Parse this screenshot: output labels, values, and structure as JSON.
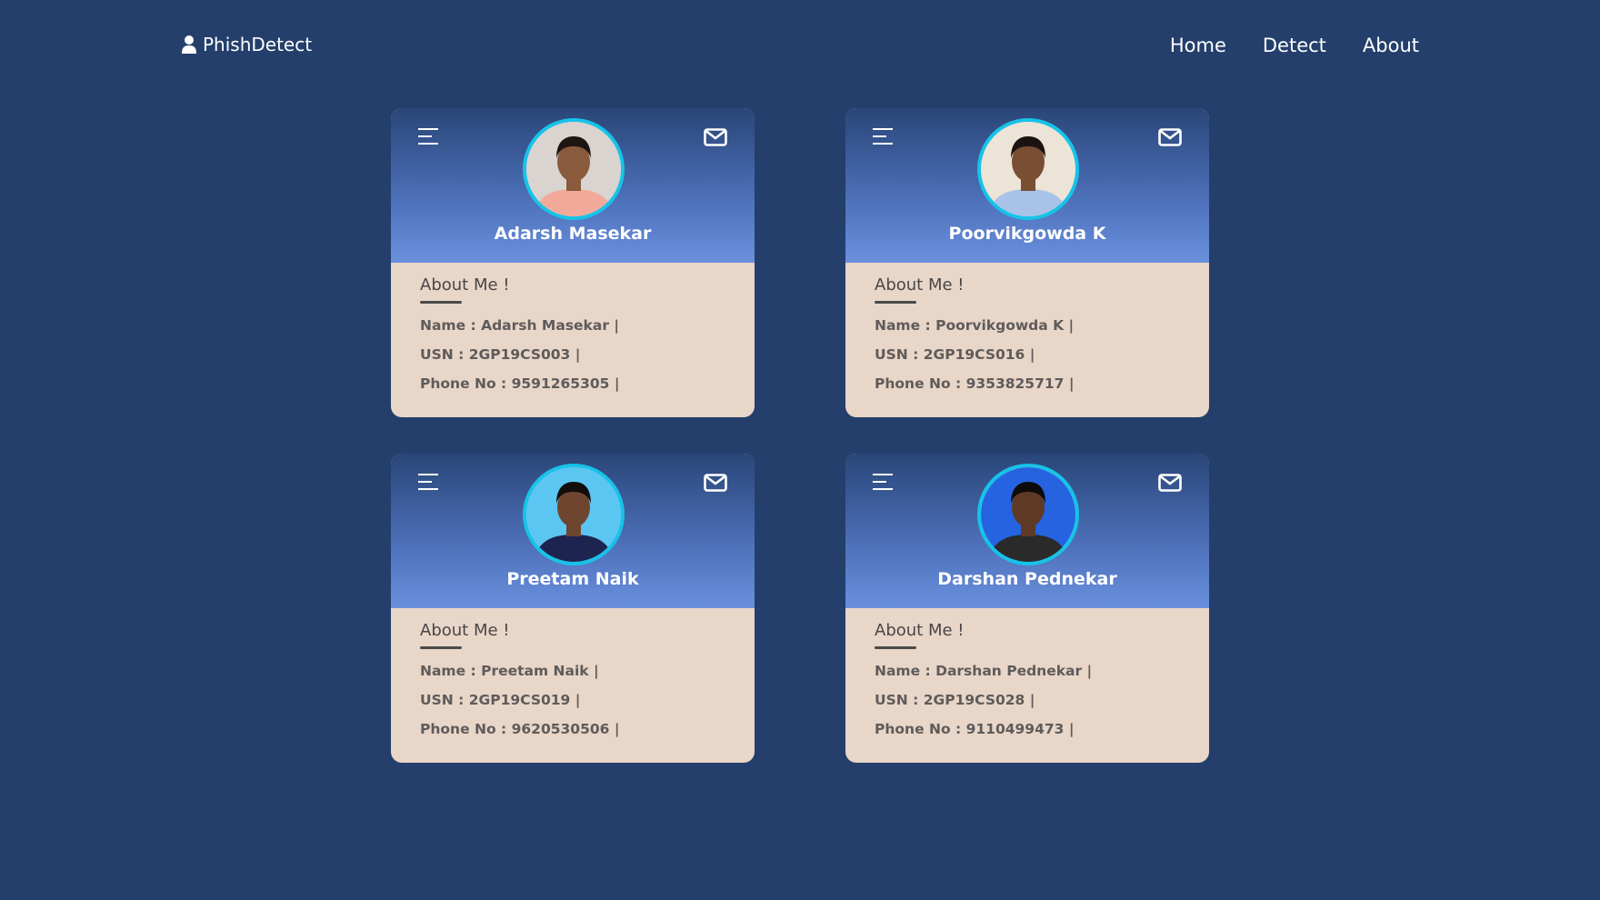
{
  "nav": {
    "brand": "PhishDetect",
    "brand_icon": "user-icon",
    "links": [
      "Home",
      "Detect",
      "About"
    ]
  },
  "colors": {
    "background": "#243f6b",
    "card_header_top": "#2a4678",
    "card_header_bottom": "#6a90de",
    "card_body": "#e8d6c8",
    "avatar_ring": "#17c3e8"
  },
  "cards": [
    {
      "name": "Adarsh Masekar",
      "about_title": "About Me !",
      "name_line": "Name : Adarsh Masekar |",
      "usn_line": "USN : 2GP19CS003 |",
      "phone_line": "Phone No : 9591265305 |",
      "photo_bg": "#d9d4d0",
      "shirt_color": "#f3a99a",
      "skin_color": "#8a5a3c",
      "hair_color": "#1c1512"
    },
    {
      "name": "Poorvikgowda K",
      "about_title": "About Me !",
      "name_line": "Name : Poorvikgowda K |",
      "usn_line": "USN : 2GP19CS016 |",
      "phone_line": "Phone No : 9353825717 |",
      "photo_bg": "#ece4d6",
      "shirt_color": "#a9c2e8",
      "skin_color": "#7a4e33",
      "hair_color": "#1a1310"
    },
    {
      "name": "Preetam Naik",
      "about_title": "About Me !",
      "name_line": "Name : Preetam Naik |",
      "usn_line": "USN : 2GP19CS019 |",
      "phone_line": "Phone No : 9620530506 |",
      "photo_bg": "#5cc6f2",
      "shirt_color": "#1e2450",
      "skin_color": "#6e4630",
      "hair_color": "#120e0c"
    },
    {
      "name": "Darshan Pednekar",
      "about_title": "About Me !",
      "name_line": "Name : Darshan Pednekar |",
      "usn_line": "USN : 2GP19CS028 |",
      "phone_line": "Phone No : 9110499473 |",
      "photo_bg": "#2563e0",
      "shirt_color": "#2a2a2a",
      "skin_color": "#5e3a26",
      "hair_color": "#0e0b0a"
    }
  ]
}
